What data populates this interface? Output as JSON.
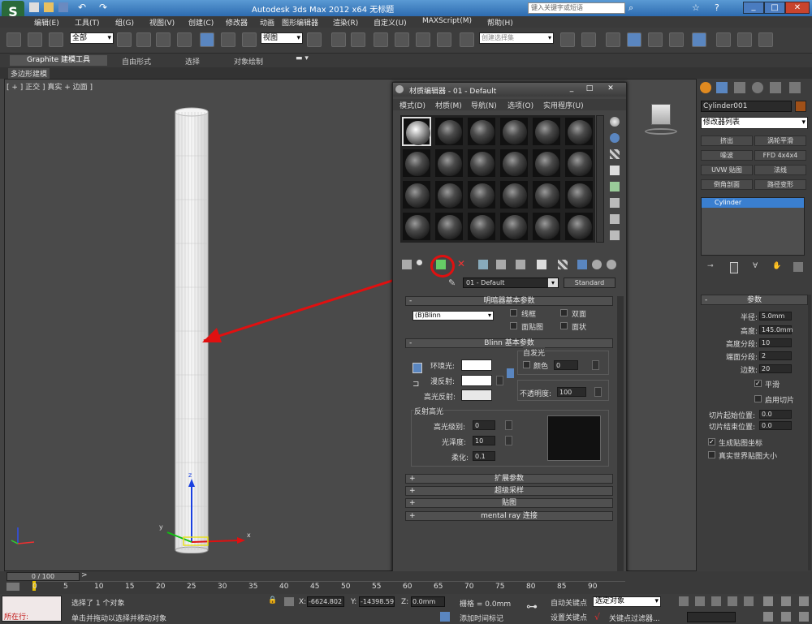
{
  "window": {
    "title": "Autodesk 3ds Max  2012  x64      无标题",
    "search_placeholder": "键入关键字或短语"
  },
  "menu": [
    "编辑(E)",
    "工具(T)",
    "组(G)",
    "视图(V)",
    "创建(C)",
    "修改器",
    "动画",
    "图形编辑器",
    "渲染(R)",
    "自定义(U)",
    "MAXScript(M)",
    "帮助(H)"
  ],
  "toolbar": {
    "selection_filter": "全部",
    "view_dropdown": "视图",
    "named_selection": "创建选择集"
  },
  "ribbon": {
    "tabs": [
      "Graphite 建模工具",
      "自由形式",
      "选择",
      "对象绘制"
    ],
    "subtab": "多边形建模"
  },
  "viewport": {
    "label": "[ + ] 正交 ] 真实 + 边面 ]"
  },
  "material_editor": {
    "title": "材质编辑器 - 01 - Default",
    "menus": [
      "模式(D)",
      "材质(M)",
      "导航(N)",
      "选项(O)",
      "实用程序(U)"
    ],
    "material_name": "01 - Default",
    "material_type": "Standard",
    "shader_rollout": {
      "title": "明暗器基本参数",
      "shader": "(B)Blinn",
      "options": [
        "线框",
        "双面",
        "面贴图",
        "面状"
      ]
    },
    "blinn_rollout": {
      "title": "Blinn 基本参数",
      "self_illum": "自发光",
      "color_label": "颜色",
      "color_value": "0",
      "ambient": "环境光:",
      "diffuse": "漫反射:",
      "specular": "高光反射:",
      "opacity_label": "不透明度:",
      "opacity_value": "100",
      "specular_highlights": "反射高光",
      "spec_level_label": "高光级别:",
      "spec_level": "0",
      "glossiness_label": "光泽度:",
      "glossiness": "10",
      "soften_label": "柔化:",
      "soften": "0.1"
    },
    "collapsed_rollouts": [
      "扩展参数",
      "超级采样",
      "贴图",
      "mental ray 连接"
    ]
  },
  "command_panel": {
    "object_name": "Cylinder001",
    "modifier_list": "修改器列表",
    "modifier_buttons": [
      "挤出",
      "涡轮平滑",
      "噪波",
      "FFD 4x4x4",
      "UVW 贴图",
      "法线",
      "倒角剖面",
      "路径变形"
    ],
    "stack_item": "Cylinder",
    "params_title": "参数",
    "params": [
      {
        "label": "半径:",
        "value": "5.0mm"
      },
      {
        "label": "高度:",
        "value": "145.0mm"
      },
      {
        "label": "高度分段:",
        "value": "10"
      },
      {
        "label": "端面分段:",
        "value": "2"
      },
      {
        "label": "边数:",
        "value": "20"
      }
    ],
    "smooth": "平滑",
    "slice_on": "启用切片",
    "slice_from": "切片起始位置:",
    "slice_from_value": "0.0",
    "slice_to": "切片结束位置:",
    "slice_to_value": "0.0",
    "gen_map": "生成贴图坐标",
    "real_world": "真实世界贴图大小"
  },
  "timeline": {
    "frame": "0 / 100",
    "ticks": [
      "0",
      "5",
      "10",
      "15",
      "20",
      "25",
      "30",
      "35",
      "40",
      "45",
      "50",
      "55",
      "60",
      "65",
      "70",
      "75",
      "80",
      "85",
      "90"
    ]
  },
  "status": {
    "running": "所在行:",
    "selected": "选择了 1 个对象",
    "hint": "单击并拖动以选择并移动对象",
    "x_value": "-6624.802",
    "y_value": "-14398.59",
    "z_value": "0.0mm",
    "grid": "栅格 = 0.0mm",
    "auto_key": "自动关键点",
    "set_key": "设置关键点",
    "selected_dropdown": "选定对象",
    "key_filter": "关键点过滤器...",
    "add_time_tag": "添加时间标记",
    "x_label": "X:",
    "y_label": "Y:",
    "z_label": "Z:"
  },
  "colors": {
    "highlight": "#e01010",
    "selection_blue": "#3a7fd0"
  }
}
